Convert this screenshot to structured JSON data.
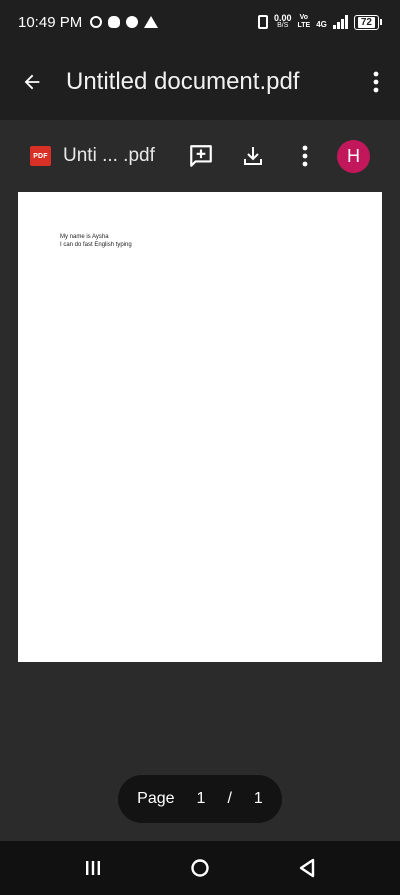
{
  "status_bar": {
    "time": "10:49 PM",
    "net_speed_value": "0.00",
    "net_speed_unit": "B/S",
    "volte_top": "Vo",
    "volte_bottom": "LTE",
    "network": "4G",
    "battery": "72"
  },
  "app_bar": {
    "title": "Untitled document.pdf",
    "back_icon": "arrow-left-icon",
    "overflow_icon": "more-vert-icon"
  },
  "viewer_toolbar": {
    "file_badge": "PDF",
    "file_name": "Unti ... .pdf",
    "avatar_letter": "H",
    "avatar_color": "#c2185b",
    "icons": [
      "add-comment-icon",
      "download-icon",
      "more-vert-icon"
    ]
  },
  "document": {
    "lines": [
      "My name is Aysha",
      "I can do fast English typing"
    ]
  },
  "page_indicator": {
    "label": "Page",
    "current": "1",
    "separator": "/",
    "total": "1"
  },
  "colors": {
    "pdf_red": "#d93025",
    "app_bar_bg": "#1f1f1f",
    "viewer_bg": "#2b2b2b"
  }
}
